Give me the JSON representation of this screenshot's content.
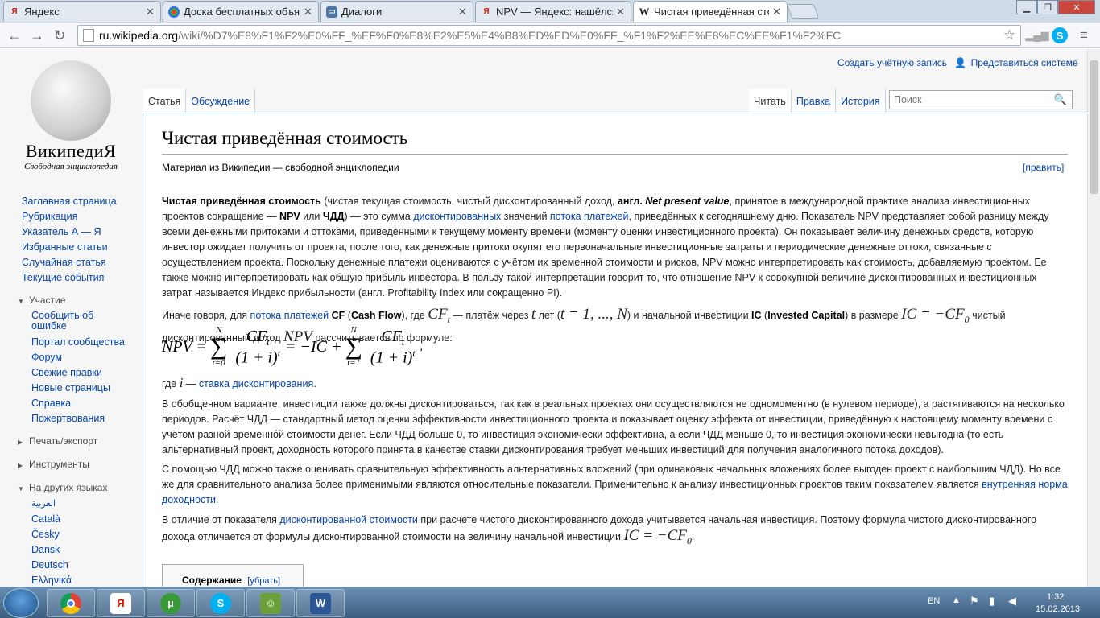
{
  "tabs": [
    {
      "title": "Яндекс",
      "icon": "yandex-icon"
    },
    {
      "title": "Доска бесплатных объяв",
      "icon": "board-icon"
    },
    {
      "title": "Диалоги",
      "icon": "dialogs-icon"
    },
    {
      "title": "NPV — Яндекс: нашёлся",
      "icon": "yandex-icon"
    },
    {
      "title": "Чистая приведённая сто",
      "icon": "wikipedia-icon"
    }
  ],
  "address": {
    "host": "ru.wikipedia.org",
    "path": "/wiki/%D7%E8%F1%F2%E0%FF_%EF%F0%E8%E2%E5%E4%B8%ED%ED%E0%FF_%F1%F2%EE%E8%EC%EE%F1%F2%FC"
  },
  "logo": {
    "wordmark": "ВикипедиЯ",
    "tagline": "Свободная энциклопедия"
  },
  "sidebar": {
    "nav": [
      "Заглавная страница",
      "Рубрикация",
      "Указатель А — Я",
      "Избранные статьи",
      "Случайная статья",
      "Текущие события"
    ],
    "participation_head": "Участие",
    "participation": [
      "Сообщить об ошибке",
      "Портал сообщества",
      "Форум",
      "Свежие правки",
      "Новые страницы",
      "Справка",
      "Пожертвования"
    ],
    "print_head": "Печать/экспорт",
    "tools_head": "Инструменты",
    "langs_head": "На других языках",
    "langs": [
      "العربية",
      "Català",
      "Česky",
      "Dansk",
      "Deutsch",
      "Ελληνικά"
    ]
  },
  "personal": {
    "create": "Создать учётную запись",
    "login": "Представиться системе"
  },
  "page_tabs": {
    "article": "Статья",
    "talk": "Обсуждение",
    "read": "Читать",
    "edit": "Правка",
    "history": "История"
  },
  "search": {
    "placeholder": "Поиск"
  },
  "article": {
    "title": "Чистая приведённая стоимость",
    "subtitle": "Материал из Википедии — свободной энциклопедии",
    "edit": "[править]",
    "toc_title": "Содержание",
    "toc_toggle": "[убрать]"
  },
  "taskbar": {
    "lang": "EN",
    "time": "1:32",
    "date": "15.02.2013"
  }
}
